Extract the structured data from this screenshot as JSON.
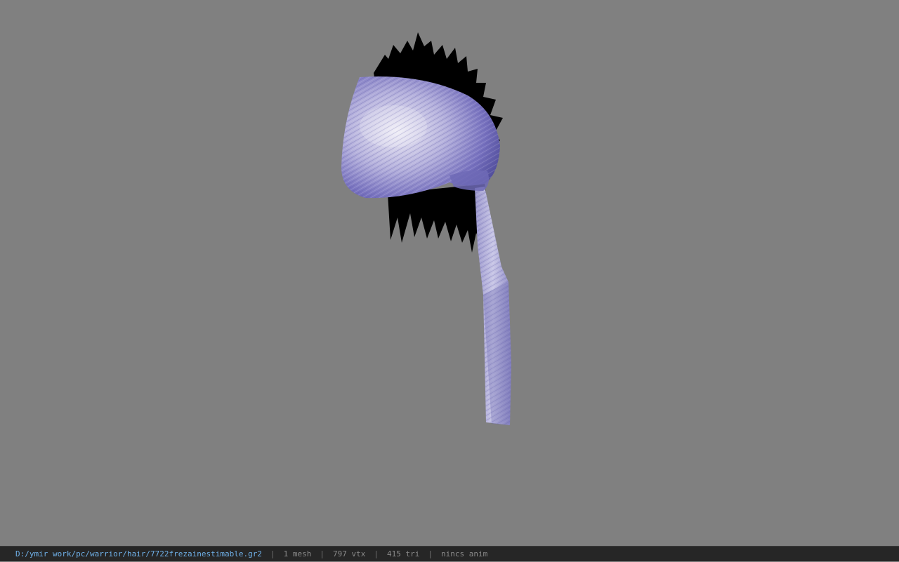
{
  "viewport": {
    "background": "#808080",
    "model": {
      "name": "hair-model",
      "hair_color": "#000000",
      "bandana_color": "#8a86c8",
      "bandana_highlight": "#e4e2f2",
      "bandana_shadow": "#4e4a96"
    }
  },
  "statusbar": {
    "file_path": "D:/ymir work/pc/warrior/hair/7722frezainestimable.gr2",
    "separator": "|",
    "mesh_count": "1 mesh",
    "vertex_count": "797 vtx",
    "triangle_count": "415 tri",
    "anim_status": "nincs anim",
    "path_color": "#6fb0e8",
    "text_color": "#8a8a8a",
    "background": "#262626"
  }
}
